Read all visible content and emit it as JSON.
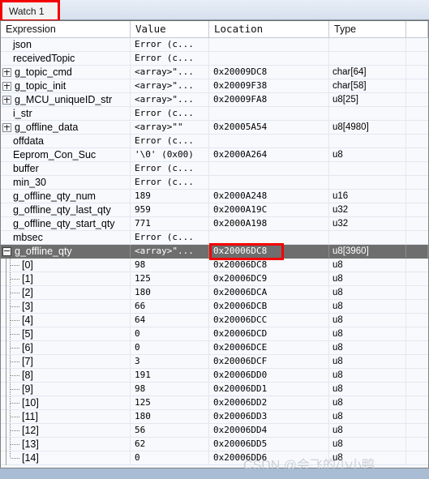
{
  "window": {
    "tab_label": "Watch 1",
    "accent_annotation_color": "#f50000",
    "selection_color": "#6e6e6e",
    "row_background": "#f7f9fd"
  },
  "columns": [
    {
      "key": "expression",
      "label": "Expression"
    },
    {
      "key": "value",
      "label": "Value"
    },
    {
      "key": "location",
      "label": "Location"
    },
    {
      "key": "type",
      "label": "Type"
    }
  ],
  "rows": [
    {
      "expression": "json",
      "value": "Error (c...",
      "location": "",
      "type": "",
      "indent": 0,
      "expander": "none",
      "selected": false
    },
    {
      "expression": "receivedTopic",
      "value": "Error (c...",
      "location": "",
      "type": "",
      "indent": 0,
      "expander": "none",
      "selected": false
    },
    {
      "expression": "g_topic_cmd",
      "value": "<array>\"...",
      "location": "0x20009DC8",
      "type": "char[64]",
      "indent": 0,
      "expander": "plus",
      "selected": false
    },
    {
      "expression": "g_topic_init",
      "value": "<array>\"...",
      "location": "0x20009F38",
      "type": "char[58]",
      "indent": 0,
      "expander": "plus",
      "selected": false
    },
    {
      "expression": "g_MCU_uniqueID_str",
      "value": "<array>\"...",
      "location": "0x20009FA8",
      "type": "u8[25]",
      "indent": 0,
      "expander": "plus",
      "selected": false
    },
    {
      "expression": "i_str",
      "value": "Error (c...",
      "location": "",
      "type": "",
      "indent": 0,
      "expander": "none",
      "selected": false
    },
    {
      "expression": "g_offline_data",
      "value": "<array>\"\"",
      "location": "0x20005A54",
      "type": "u8[4980]",
      "indent": 0,
      "expander": "plus",
      "selected": false
    },
    {
      "expression": "offdata",
      "value": "Error (c...",
      "location": "",
      "type": "",
      "indent": 0,
      "expander": "none",
      "selected": false
    },
    {
      "expression": "Eeprom_Con_Suc",
      "value": "'\\0' (0x00)",
      "location": "0x2000A264",
      "type": "u8",
      "indent": 0,
      "expander": "none",
      "selected": false
    },
    {
      "expression": "buffer",
      "value": "Error (c...",
      "location": "",
      "type": "",
      "indent": 0,
      "expander": "none",
      "selected": false
    },
    {
      "expression": "min_30",
      "value": "Error (c...",
      "location": "",
      "type": "",
      "indent": 0,
      "expander": "none",
      "selected": false
    },
    {
      "expression": "g_offline_qty_num",
      "value": "189",
      "location": "0x2000A248",
      "type": "u16",
      "indent": 0,
      "expander": "none",
      "selected": false
    },
    {
      "expression": "g_offline_qty_last_qty",
      "value": "959",
      "location": "0x2000A19C",
      "type": "u32",
      "indent": 0,
      "expander": "none",
      "selected": false
    },
    {
      "expression": "g_offline_qty_start_qty",
      "value": "771",
      "location": "0x2000A198",
      "type": "u32",
      "indent": 0,
      "expander": "none",
      "selected": false
    },
    {
      "expression": "mbsec",
      "value": "Error (c...",
      "location": "",
      "type": "",
      "indent": 0,
      "expander": "none",
      "selected": false
    },
    {
      "expression": "g_offline_qty",
      "value": "<array>\"...",
      "location": "0x20006DC8",
      "type": "u8[3960]",
      "indent": 0,
      "expander": "minus",
      "selected": true
    },
    {
      "expression": "[0]",
      "value": "98",
      "location": "0x20006DC8",
      "type": "u8",
      "indent": 1,
      "expander": "child",
      "selected": false
    },
    {
      "expression": "[1]",
      "value": "125",
      "location": "0x20006DC9",
      "type": "u8",
      "indent": 1,
      "expander": "child",
      "selected": false
    },
    {
      "expression": "[2]",
      "value": "180",
      "location": "0x20006DCA",
      "type": "u8",
      "indent": 1,
      "expander": "child",
      "selected": false
    },
    {
      "expression": "[3]",
      "value": "66",
      "location": "0x20006DCB",
      "type": "u8",
      "indent": 1,
      "expander": "child",
      "selected": false
    },
    {
      "expression": "[4]",
      "value": "64",
      "location": "0x20006DCC",
      "type": "u8",
      "indent": 1,
      "expander": "child",
      "selected": false
    },
    {
      "expression": "[5]",
      "value": "0",
      "location": "0x20006DCD",
      "type": "u8",
      "indent": 1,
      "expander": "child",
      "selected": false
    },
    {
      "expression": "[6]",
      "value": "0",
      "location": "0x20006DCE",
      "type": "u8",
      "indent": 1,
      "expander": "child",
      "selected": false
    },
    {
      "expression": "[7]",
      "value": "3",
      "location": "0x20006DCF",
      "type": "u8",
      "indent": 1,
      "expander": "child",
      "selected": false
    },
    {
      "expression": "[8]",
      "value": "191",
      "location": "0x20006DD0",
      "type": "u8",
      "indent": 1,
      "expander": "child",
      "selected": false
    },
    {
      "expression": "[9]",
      "value": "98",
      "location": "0x20006DD1",
      "type": "u8",
      "indent": 1,
      "expander": "child",
      "selected": false
    },
    {
      "expression": "[10]",
      "value": "125",
      "location": "0x20006DD2",
      "type": "u8",
      "indent": 1,
      "expander": "child",
      "selected": false
    },
    {
      "expression": "[11]",
      "value": "180",
      "location": "0x20006DD3",
      "type": "u8",
      "indent": 1,
      "expander": "child",
      "selected": false
    },
    {
      "expression": "[12]",
      "value": "56",
      "location": "0x20006DD4",
      "type": "u8",
      "indent": 1,
      "expander": "child",
      "selected": false
    },
    {
      "expression": "[13]",
      "value": "62",
      "location": "0x20006DD5",
      "type": "u8",
      "indent": 1,
      "expander": "child",
      "selected": false
    },
    {
      "expression": "[14]",
      "value": "0",
      "location": "0x20006DD6",
      "type": "u8",
      "indent": 1,
      "expander": "child",
      "selected": false
    }
  ],
  "watermark": "CSDN @会飞的小小鸭"
}
